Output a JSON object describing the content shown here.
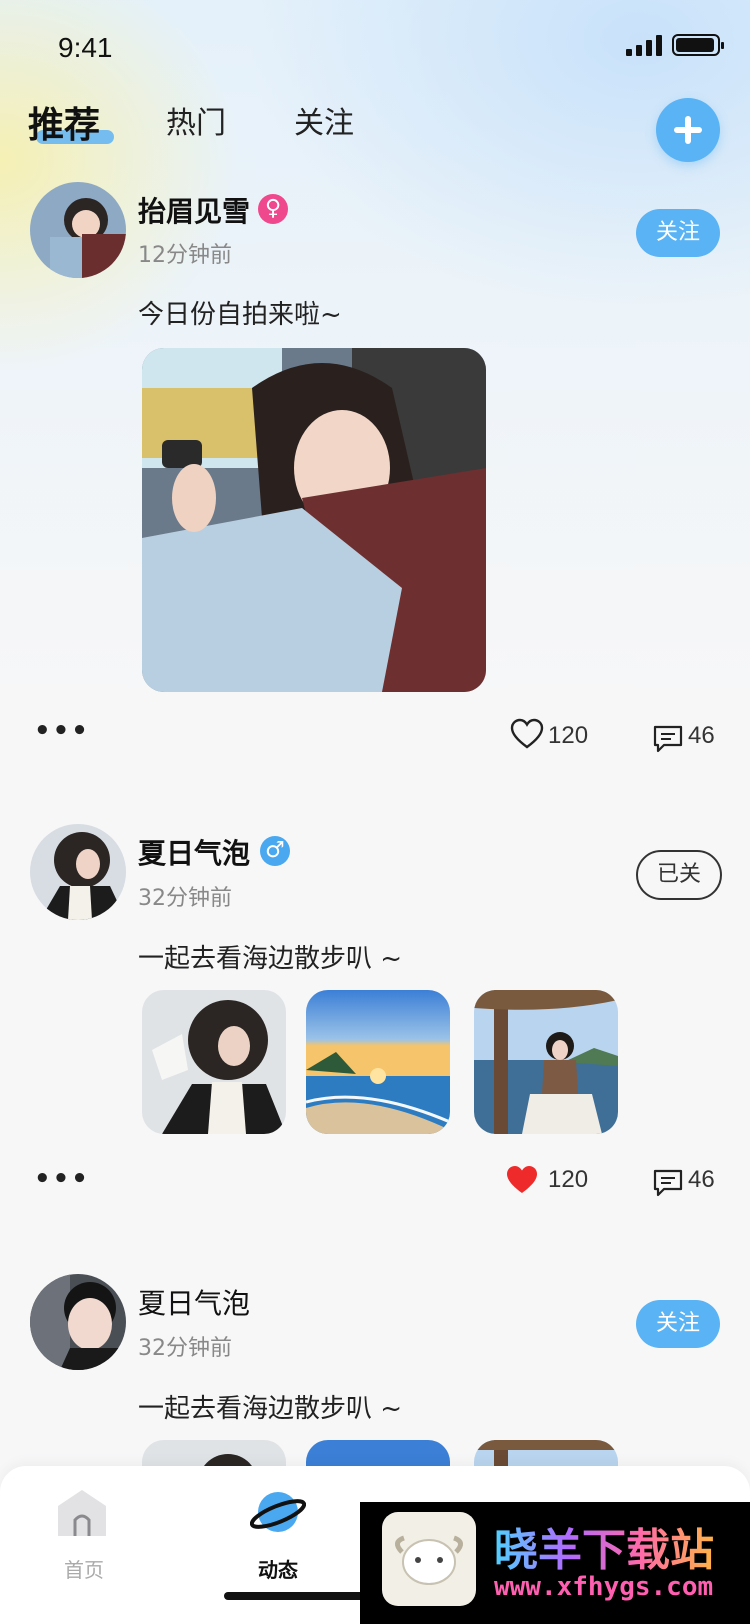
{
  "status_bar": {
    "time": "9:41"
  },
  "tabs": [
    {
      "label": "推荐",
      "active": true
    },
    {
      "label": "热门",
      "active": false
    },
    {
      "label": "关注",
      "active": false
    }
  ],
  "posts": [
    {
      "username": "抬眉见雪",
      "gender_symbol": "♀",
      "time": "12分钟前",
      "follow_label": "关注",
      "text": "今日份自拍来啦~",
      "likes": "120",
      "comments": "46",
      "liked": false
    },
    {
      "username": "夏日气泡",
      "gender_symbol": "♂",
      "time": "32分钟前",
      "follow_label": "已关",
      "text": "一起去看海边散步叭 ~",
      "likes": "120",
      "comments": "46",
      "liked": true
    },
    {
      "username": "夏日气泡",
      "time": "32分钟前",
      "follow_label": "关注",
      "text": "一起去看海边散步叭 ~"
    }
  ],
  "bottom_nav": [
    {
      "label": "首页",
      "icon": "home-icon",
      "active": false
    },
    {
      "label": "动态",
      "icon": "planet-icon",
      "active": true
    }
  ],
  "watermark": {
    "title": "晓羊下载站",
    "url": "www.xfhygs.com"
  },
  "colors": {
    "accent": "#5ab3f4",
    "like_red": "#ee2a2a",
    "female": "#f0488c",
    "male": "#4aa8f0"
  }
}
